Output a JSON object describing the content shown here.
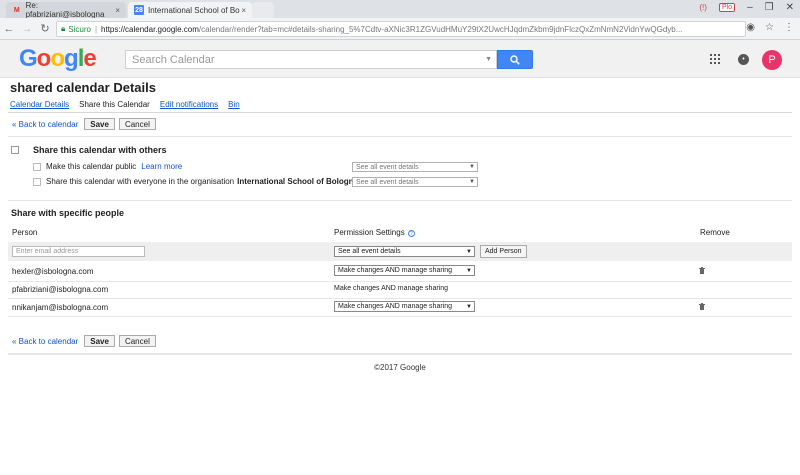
{
  "browser": {
    "tabs": [
      {
        "label": "Re: pfabriziani@isbologna",
        "icon": "gmail-icon",
        "close": "×"
      },
      {
        "label": "International School of Bo",
        "icon": "calendar-icon",
        "icon_text": "28",
        "close": "×"
      }
    ],
    "address": {
      "secure_label": "Sicuro",
      "separator": "|",
      "host": "https://calendar.google.com",
      "path": "/calendar/render?tab=mc#details-sharing_5%7Cdtv-aXNic3R1ZGVudHMuY29tX2UwcHJqdmZkbm9jdnFlczQxZmNmN2VidnYwQGdyb..."
    }
  },
  "header": {
    "logo": [
      "G",
      "o",
      "o",
      "g",
      "l",
      "e"
    ],
    "search_placeholder": "Search Calendar",
    "avatar_letter": "P",
    "colors": {
      "search_button": "#4285f4",
      "avatar": "#e8336b"
    }
  },
  "page": {
    "title": "shared calendar Details",
    "tabs": [
      {
        "label": "Calendar Details",
        "active": false
      },
      {
        "label": "Share this Calendar",
        "active": true
      },
      {
        "label": "Edit notifications",
        "active": false
      },
      {
        "label": "Bin",
        "active": false
      }
    ],
    "back_link": "« Back to calendar",
    "save_label": "Save",
    "cancel_label": "Cancel"
  },
  "share_others": {
    "heading": "Share this calendar with others",
    "public_label": "Make this calendar public",
    "learn_more": "Learn more",
    "org_label_prefix": "Share this calendar with everyone in the organisation",
    "org_name": "International School of Bologna",
    "public_select": "See all event details",
    "org_select": "See all event details"
  },
  "specific": {
    "heading": "Share with specific people",
    "col_person": "Person",
    "col_permission": "Permission Settings",
    "col_remove": "Remove",
    "email_placeholder": "Enter email address",
    "new_permission": "See all event details",
    "add_person": "Add Person",
    "people": [
      {
        "email": "hexler@isbologna.com",
        "permission": "Make changes AND manage sharing",
        "editable": true
      },
      {
        "email": "pfabriziani@isbologna.com",
        "permission": "Make changes AND manage sharing",
        "editable": false
      },
      {
        "email": "nnikanjam@isbologna.com",
        "permission": "Make changes AND manage sharing",
        "editable": true
      }
    ]
  },
  "footer": {
    "copyright": "©2017 Google"
  }
}
